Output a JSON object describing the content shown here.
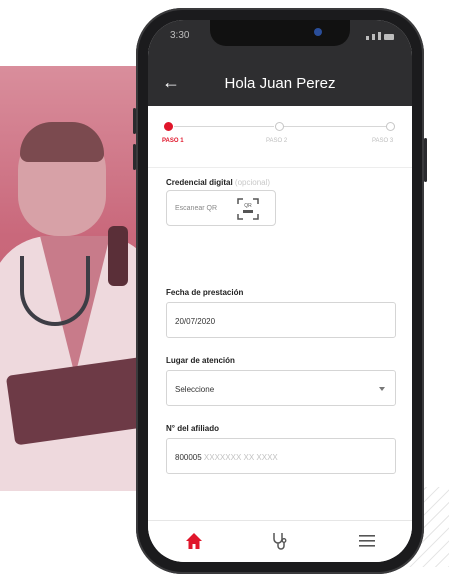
{
  "app": {
    "title": "Hola Juan Perez",
    "status_time": "3:30"
  },
  "stepper": {
    "steps": [
      {
        "label": "PASO 1",
        "active": true
      },
      {
        "label": "PASO 2",
        "active": false
      },
      {
        "label": "PASO 3",
        "active": false
      }
    ]
  },
  "form": {
    "credential": {
      "label": "Credencial digital",
      "optional_hint": "(opcional)",
      "scan_button_label": "Escanear QR",
      "qr_badge_text": "QR"
    },
    "date": {
      "label": "Fecha de prestación",
      "value": "20/07/2020"
    },
    "place": {
      "label": "Lugar de atención",
      "value": "Seleccione"
    },
    "member": {
      "label": "N° del afiliado",
      "value_prefix": "800005",
      "value_masked": " XXXXXXX XX XXXX"
    }
  },
  "bottom_nav": {
    "items": [
      {
        "icon": "home-icon",
        "active": true
      },
      {
        "icon": "stethoscope-icon",
        "active": false
      },
      {
        "icon": "menu-icon",
        "active": false
      }
    ]
  },
  "colors": {
    "accent": "#e0162b",
    "app_bar": "#2e2e30",
    "photo_tint": "#c55e73"
  }
}
